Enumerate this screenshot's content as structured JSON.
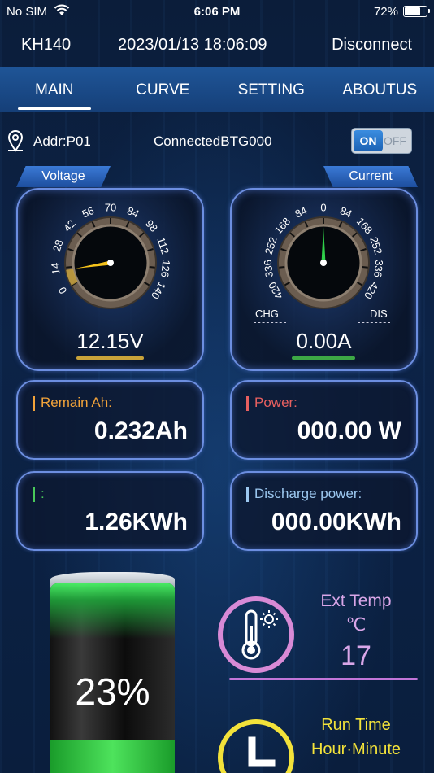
{
  "status_bar": {
    "carrier": "No SIM",
    "time": "6:06 PM",
    "battery_pct": "72%",
    "battery_level": 0.72
  },
  "header": {
    "device": "KH140",
    "datetime": "2023/01/13 18:06:09",
    "disconnect": "Disconnect"
  },
  "tabs": [
    {
      "label": "MAIN",
      "active": true
    },
    {
      "label": "CURVE",
      "active": false
    },
    {
      "label": "SETTING",
      "active": false
    },
    {
      "label": "ABOUTUS",
      "active": false
    }
  ],
  "address_row": {
    "addr": "Addr:P01",
    "connection": "ConnectedBTG000",
    "toggle_on": "ON",
    "toggle_off": "OFF"
  },
  "voltage_gauge": {
    "label": "Voltage",
    "value": "12.15V",
    "reading": 12.15,
    "ticks": [
      "0",
      "14",
      "28",
      "42",
      "56",
      "70",
      "84",
      "98",
      "112",
      "126",
      "140"
    ],
    "color": "#f5c21b"
  },
  "current_gauge": {
    "label": "Current",
    "value": "0.00A",
    "reading": 0.0,
    "ticks": [
      "420",
      "336",
      "252",
      "168",
      "84",
      "0",
      "84",
      "168",
      "252",
      "336",
      "420"
    ],
    "chg": "CHG",
    "dis": "DIS",
    "color": "#2fd04a"
  },
  "info": {
    "remain_ah": {
      "label": "Remain Ah:",
      "value": "0.232Ah",
      "color": "#f2a33a"
    },
    "power": {
      "label": "Power:",
      "value": "000.00 W",
      "color": "#e86060"
    },
    "energy": {
      "label": ":",
      "value": "1.26KWh",
      "color": "#49c95a"
    },
    "discharge": {
      "label": "Discharge power:",
      "value": "000.00KWh",
      "color": "#9cc8f0"
    }
  },
  "battery": {
    "percent": "23%",
    "level": 0.23
  },
  "ext_temp": {
    "label": "Ext Temp",
    "unit": "℃",
    "value": "17"
  },
  "run_time": {
    "label": "Run Time",
    "unit": "Hour·Minute"
  }
}
